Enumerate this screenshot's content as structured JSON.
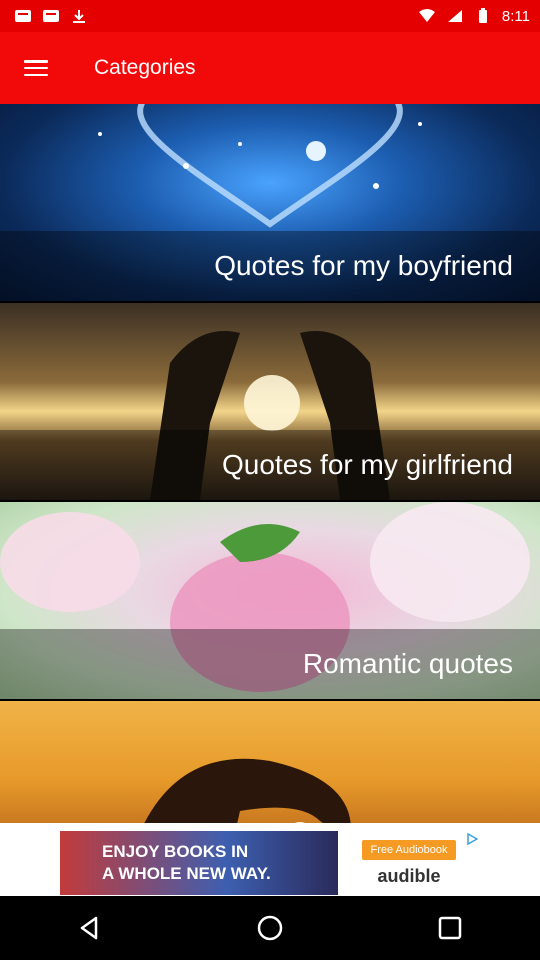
{
  "status": {
    "time": "8:11"
  },
  "app_bar": {
    "title": "Categories"
  },
  "categories": [
    {
      "label": "Quotes for my boyfriend"
    },
    {
      "label": "Quotes for my girlfriend"
    },
    {
      "label": "Romantic quotes"
    },
    {
      "label": ""
    }
  ],
  "ad": {
    "headline_line1": "ENJOY BOOKS IN",
    "headline_line2": "A WHOLE NEW WAY.",
    "cta": "Free Audiobook",
    "brand": "audible"
  },
  "colors": {
    "app_bar": "#f20a0a",
    "status_bar": "#e50000"
  }
}
